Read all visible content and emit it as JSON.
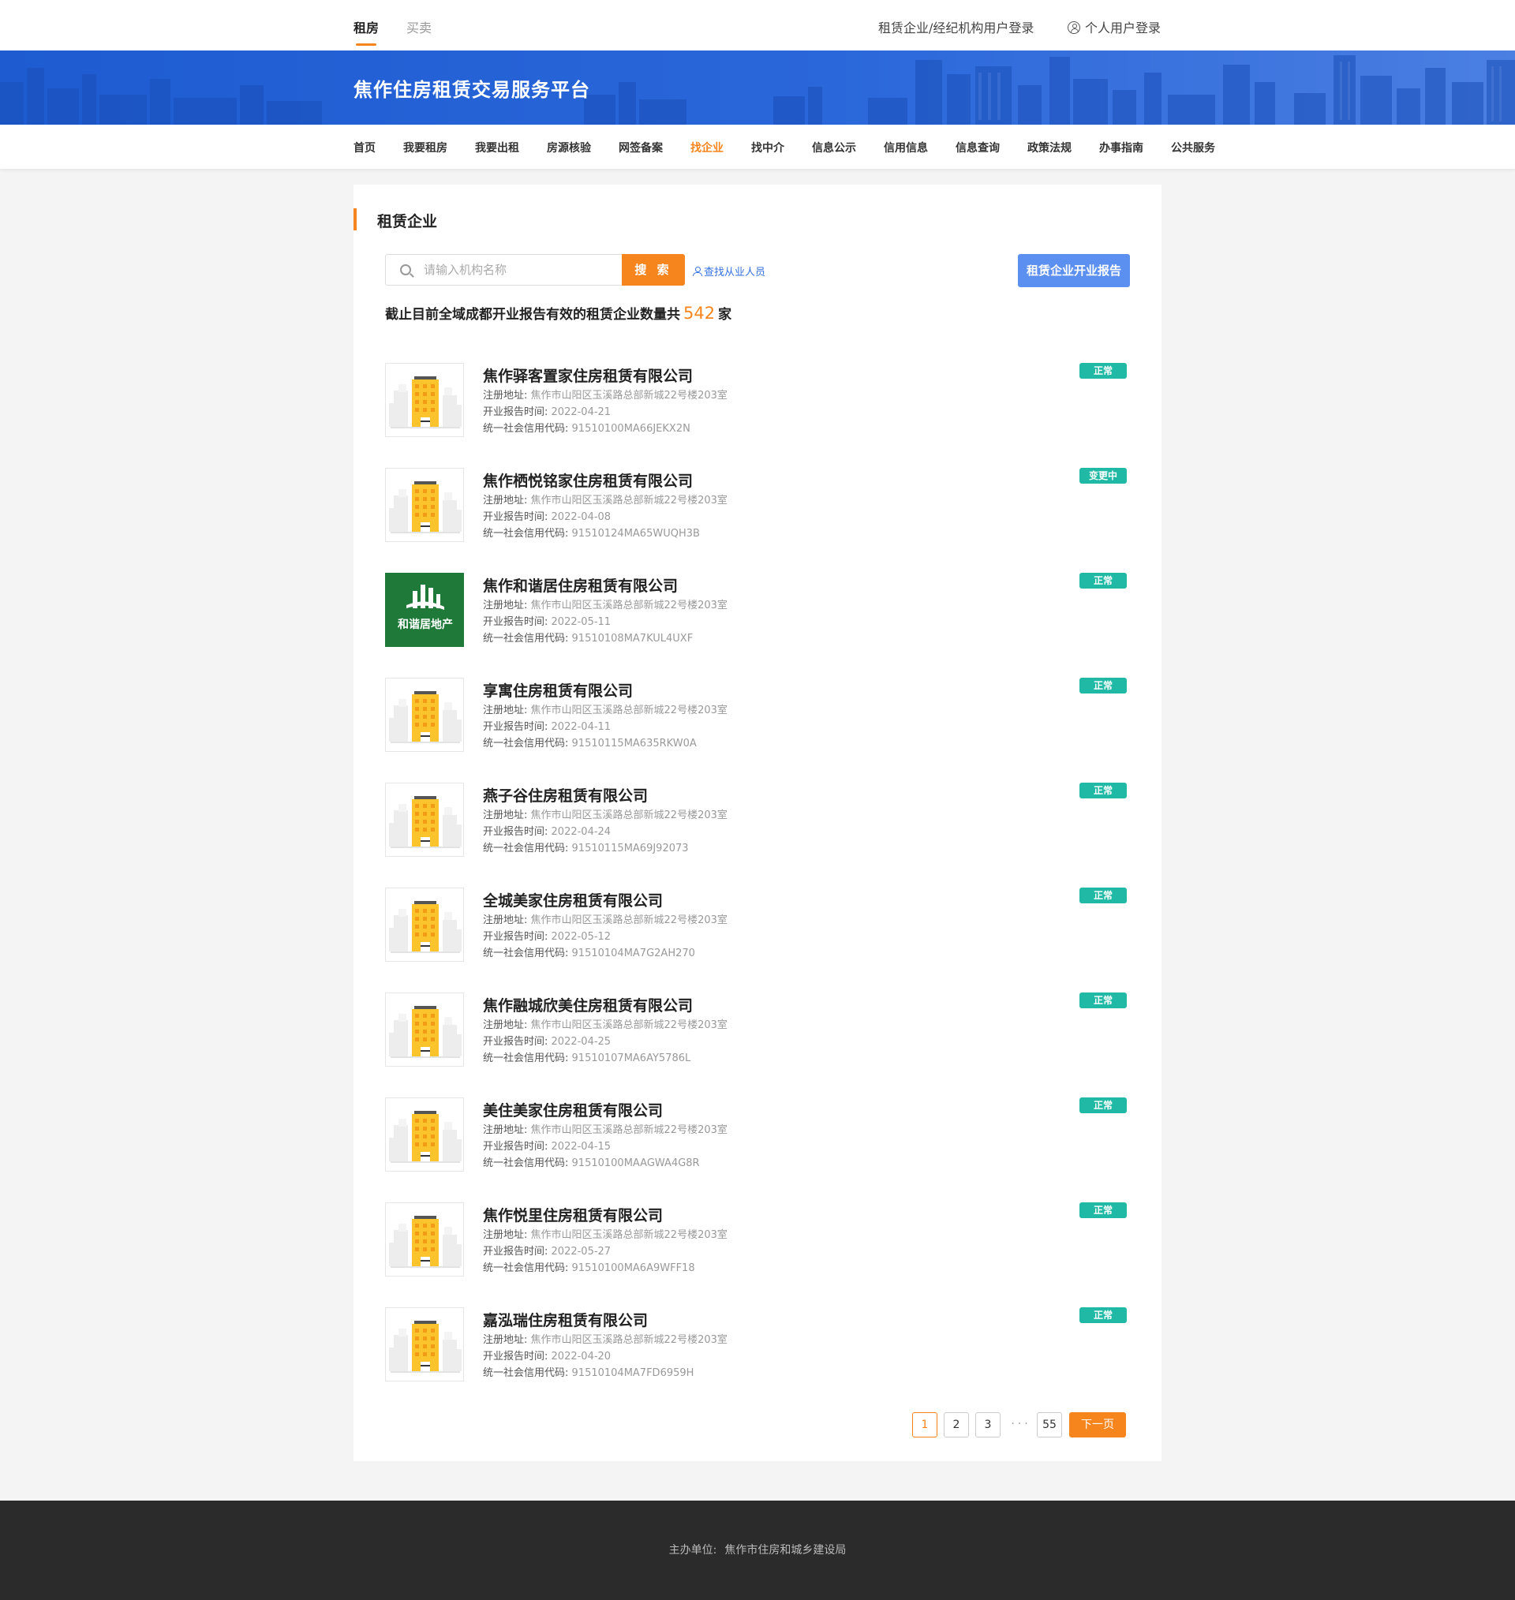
{
  "topbar": {
    "tab_rent": "租房",
    "tab_sale": "买卖",
    "company_login": "租赁企业/经纪机构用户登录",
    "personal_login": "个人用户登录"
  },
  "banner": {
    "title": "焦作住房租赁交易服务平台"
  },
  "nav": {
    "items": [
      "首页",
      "我要租房",
      "我要出租",
      "房源核验",
      "网签备案",
      "找企业",
      "找中介",
      "信息公示",
      "信用信息",
      "信息查询",
      "政策法规",
      "办事指南",
      "公共服务"
    ],
    "active": "找企业"
  },
  "section": {
    "title": "租赁企业"
  },
  "search": {
    "placeholder": "请输入机构名称",
    "button": "搜 索",
    "find_staff": "查找从业人员",
    "report_button": "租赁企业开业报告"
  },
  "summary": {
    "prefix": "截止目前全域成都开业报告有效的租赁企业数量共",
    "count": "542",
    "suffix": "家"
  },
  "labels": {
    "address": "注册地址:",
    "report_date": "开业报告时间:",
    "credit_code": "统一社会信用代码:"
  },
  "companies": [
    {
      "name": "焦作驿客置家住房租赁有限公司",
      "address": "焦作市山阳区玉溪路总部新城22号楼203室",
      "date": "2022-04-21",
      "code": "91510100MA66JEKX2N",
      "status": "正常",
      "logo": "building-placeholder"
    },
    {
      "name": "焦作栖悦铭家住房租赁有限公司",
      "address": "焦作市山阳区玉溪路总部新城22号楼203室",
      "date": "2022-04-08",
      "code": "91510124MA65WUQH3B",
      "status": "变更中",
      "logo": "building-placeholder"
    },
    {
      "name": "焦作和谐居住房租赁有限公司",
      "address": "焦作市山阳区玉溪路总部新城22号楼203室",
      "date": "2022-05-11",
      "code": "91510108MA7KUL4UXF",
      "status": "正常",
      "logo": "hexieju-brand",
      "brand_text": "和谐居地产"
    },
    {
      "name": "享寓住房租赁有限公司",
      "address": "焦作市山阳区玉溪路总部新城22号楼203室",
      "date": "2022-04-11",
      "code": "91510115MA635RKW0A",
      "status": "正常",
      "logo": "building-placeholder"
    },
    {
      "name": "燕子谷住房租赁有限公司",
      "address": "焦作市山阳区玉溪路总部新城22号楼203室",
      "date": "2022-04-24",
      "code": "91510115MA69J92073",
      "status": "正常",
      "logo": "building-placeholder"
    },
    {
      "name": "全城美家住房租赁有限公司",
      "address": "焦作市山阳区玉溪路总部新城22号楼203室",
      "date": "2022-05-12",
      "code": "91510104MA7G2AH270",
      "status": "正常",
      "logo": "building-placeholder"
    },
    {
      "name": "焦作融城欣美住房租赁有限公司",
      "address": "焦作市山阳区玉溪路总部新城22号楼203室",
      "date": "2022-04-25",
      "code": "91510107MA6AY5786L",
      "status": "正常",
      "logo": "building-placeholder"
    },
    {
      "name": "美住美家住房租赁有限公司",
      "address": "焦作市山阳区玉溪路总部新城22号楼203室",
      "date": "2022-04-15",
      "code": "91510100MAAGWA4G8R",
      "status": "正常",
      "logo": "building-placeholder"
    },
    {
      "name": "焦作悦里住房租赁有限公司",
      "address": "焦作市山阳区玉溪路总部新城22号楼203室",
      "date": "2022-05-27",
      "code": "91510100MA6A9WFF18",
      "status": "正常",
      "logo": "building-placeholder"
    },
    {
      "name": "嘉泓瑞住房租赁有限公司",
      "address": "焦作市山阳区玉溪路总部新城22号楼203室",
      "date": "2022-04-20",
      "code": "91510104MA7FD6959H",
      "status": "正常",
      "logo": "building-placeholder"
    }
  ],
  "pagination": {
    "pages": [
      "1",
      "2",
      "3"
    ],
    "ellipsis": "···",
    "last": "55",
    "current": "1",
    "next": "下一页"
  },
  "footer": {
    "label": "主办单位:",
    "organizer": "焦作市住房和城乡建设局"
  },
  "colors": {
    "accent": "#f7851d",
    "banner_blue": "#2a67da",
    "badge_teal": "#20b9a6",
    "report_button": "#5b8ff0",
    "brand_green": "#1f7a3a",
    "footer_bg": "#2b2b2b"
  }
}
